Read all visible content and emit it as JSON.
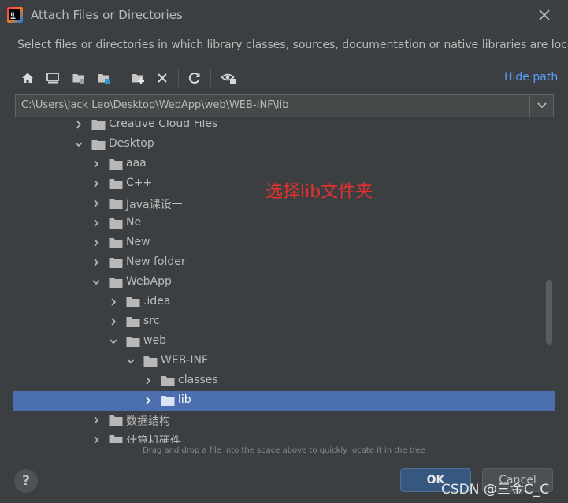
{
  "window": {
    "title": "Attach Files or Directories"
  },
  "description": "Select files or directories in which library classes, sources, documentation or native libraries are located",
  "toolbar": {
    "icons": [
      "home-icon",
      "desktop-icon",
      "project-folder-icon",
      "module-folder-icon",
      "new-folder-icon",
      "delete-icon",
      "refresh-icon",
      "show-hidden-icon"
    ],
    "hide_path": "Hide path"
  },
  "path": {
    "value": "C:\\Users\\Jack Leo\\Desktop\\WebApp\\web\\WEB-INF\\lib"
  },
  "tree": {
    "items": [
      {
        "label": "Creative Cloud Files",
        "level": 0,
        "expanded": false,
        "selected": false
      },
      {
        "label": "Desktop",
        "level": 0,
        "expanded": true,
        "selected": false
      },
      {
        "label": "aaa",
        "level": 1,
        "expanded": false,
        "selected": false
      },
      {
        "label": "C++",
        "level": 1,
        "expanded": false,
        "selected": false
      },
      {
        "label": "Java课设一",
        "level": 1,
        "expanded": false,
        "selected": false
      },
      {
        "label": "Ne",
        "level": 1,
        "expanded": false,
        "selected": false
      },
      {
        "label": "New",
        "level": 1,
        "expanded": false,
        "selected": false
      },
      {
        "label": "New folder",
        "level": 1,
        "expanded": false,
        "selected": false
      },
      {
        "label": "WebApp",
        "level": 1,
        "expanded": true,
        "selected": false
      },
      {
        "label": ".idea",
        "level": 2,
        "expanded": false,
        "selected": false
      },
      {
        "label": "src",
        "level": 2,
        "expanded": false,
        "selected": false
      },
      {
        "label": "web",
        "level": 2,
        "expanded": true,
        "selected": false
      },
      {
        "label": "WEB-INF",
        "level": 3,
        "expanded": true,
        "selected": false
      },
      {
        "label": "classes",
        "level": 4,
        "expanded": false,
        "selected": false
      },
      {
        "label": "lib",
        "level": 4,
        "expanded": false,
        "selected": true
      },
      {
        "label": "数据结构",
        "level": 1,
        "expanded": false,
        "selected": false
      },
      {
        "label": "计算机硬件",
        "level": 1,
        "expanded": false,
        "selected": false
      }
    ]
  },
  "annotation": "选择lib文件夹",
  "hint": "Drag and drop a file into the space above to quickly locate it in the tree",
  "buttons": {
    "help": "?",
    "ok": "OK",
    "cancel": "Cancel"
  },
  "watermark": "CSDN @三金C_C",
  "colors": {
    "background": "#3c3f41",
    "selection": "#4b6eaf",
    "link": "#589df6",
    "annotation": "#e8302c",
    "ok_button": "#365880"
  }
}
